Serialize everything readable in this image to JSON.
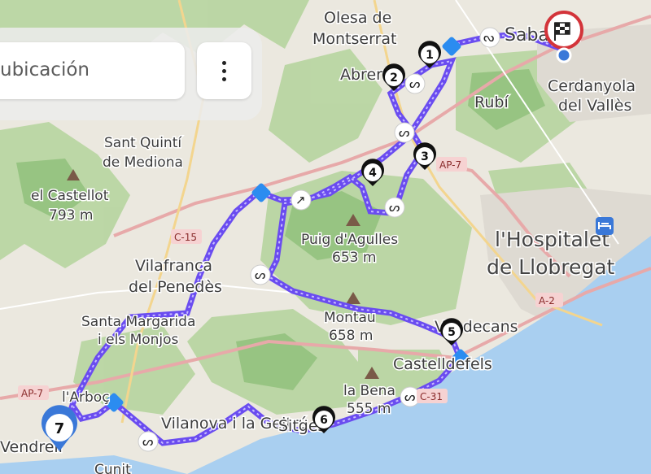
{
  "search": {
    "placeholder_text": "ubicación"
  },
  "menu": {
    "icon": "more-vertical-icon"
  },
  "places": {
    "olesa": "Olesa de",
    "montserrat": "Montserrat",
    "abrera": "Abrera",
    "sabadell": "Sabadell",
    "cerdanyola": "Cerdanyola",
    "del_valles": "del Vallès",
    "rubi": "Rubí",
    "sant_quinti": "Sant Quintí",
    "de_mediona": "de Mediona",
    "el_castellot": "el Castellot",
    "castellot_height": "793 m",
    "puig_dagulles": "Puig d'Agulles",
    "agulles_height": "653 m",
    "vilafranca": "Vilafranca",
    "del_penedes": "del Penedès",
    "hospitalet": "l'Hospitalet",
    "de_llobregat": "de Llobregat",
    "santa_margarida": "Santa Margarida",
    "i_els_monjos": "i els Monjos",
    "montau": "Montau",
    "montau_height": "658 m",
    "viladecans": "Viladecans",
    "castelldefels": "Castelldefels",
    "la_bena": "la Bena",
    "bena_height": "555 m",
    "arboc": "l'Arboç",
    "vilanova": "Vilanova i la Geltrú",
    "sitges": "Sitges",
    "vendrell": "Vendrell",
    "cunit": "Cunit"
  },
  "roads": {
    "ap7_a": "AP-7",
    "ap7_b": "AP-7",
    "c15": "C-15",
    "a2": "A-2",
    "c31": "C-31",
    "a7_top": "AP-7"
  },
  "route_color": "#6a4cf0",
  "waypoints": [
    "1",
    "2",
    "3",
    "4",
    "5",
    "6",
    "7"
  ],
  "finish_icon": "checkered-flag-icon",
  "hotel_icon": "hotel-bed-icon"
}
